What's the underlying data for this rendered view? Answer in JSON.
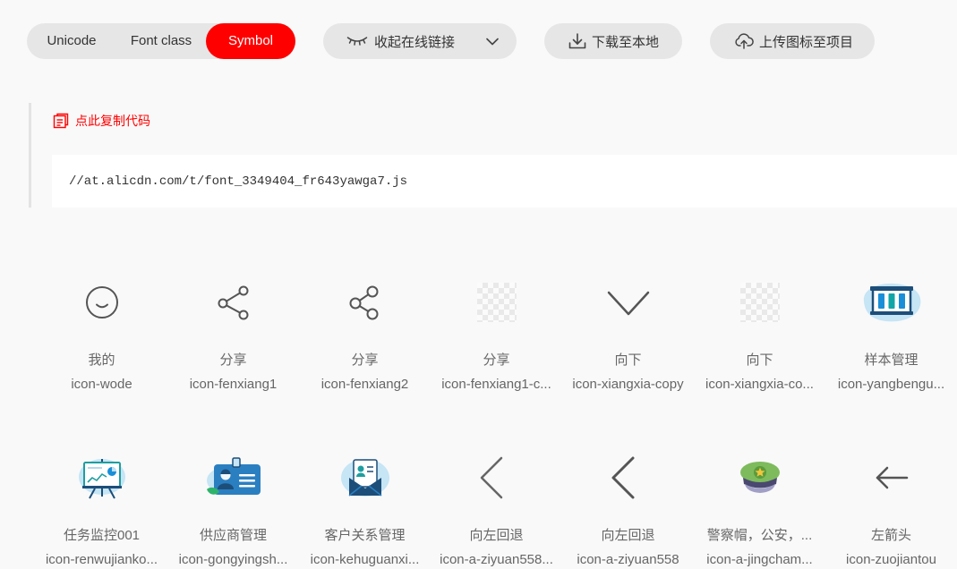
{
  "colors": {
    "accent": "#ff0000",
    "button_bg": "#e6e6e6",
    "text": "#333333",
    "muted": "#666666"
  },
  "tabs": [
    {
      "label": "Unicode",
      "selected": false
    },
    {
      "label": "Font class",
      "selected": false
    },
    {
      "label": "Symbol",
      "selected": true
    }
  ],
  "toolbar": {
    "collapse_link": {
      "label": "收起在线链接",
      "icon": "eye-closed-icon",
      "trailing_icon": "chevron-down-icon"
    },
    "download": {
      "label": "下载至本地",
      "icon": "download-icon"
    },
    "upload": {
      "label": "上传图标至项目",
      "icon": "cloud-upload-icon"
    }
  },
  "code_block": {
    "copy_label": "点此复制代码",
    "copy_icon": "copy-icon",
    "code": "//at.alicdn.com/t/font_3349404_fr643yawga7.js"
  },
  "icons": [
    {
      "name": "我的",
      "code": "icon-wode",
      "glyph": "smile-icon"
    },
    {
      "name": "分享",
      "code": "icon-fenxiang1",
      "glyph": "share-icon"
    },
    {
      "name": "分享",
      "code": "icon-fenxiang2",
      "glyph": "share-icon"
    },
    {
      "name": "分享",
      "code": "icon-fenxiang1-c...",
      "glyph": "transparent-placeholder-icon"
    },
    {
      "name": "向下",
      "code": "icon-xiangxia-copy",
      "glyph": "chevron-down-icon"
    },
    {
      "name": "向下",
      "code": "icon-xiangxia-co...",
      "glyph": "transparent-placeholder-icon"
    },
    {
      "name": "样本管理",
      "code": "icon-yangbengu...",
      "glyph": "sample-management-icon"
    },
    {
      "name": "任务监控001",
      "code": "icon-renwujianko...",
      "glyph": "task-monitor-icon"
    },
    {
      "name": "供应商管理",
      "code": "icon-gongyingsh...",
      "glyph": "supplier-card-icon"
    },
    {
      "name": "客户关系管理",
      "code": "icon-kehuguanxi...",
      "glyph": "customer-envelope-icon"
    },
    {
      "name": "向左回退",
      "code": "icon-a-ziyuan558...",
      "glyph": "chevron-left-icon"
    },
    {
      "name": "向左回退",
      "code": "icon-a-ziyuan558",
      "glyph": "chevron-left-icon"
    },
    {
      "name": "警察帽，公安，...",
      "code": "icon-a-jingcham...",
      "glyph": "police-cap-icon"
    },
    {
      "name": "左箭头",
      "code": "icon-zuojiantou",
      "glyph": "arrow-left-icon"
    }
  ]
}
